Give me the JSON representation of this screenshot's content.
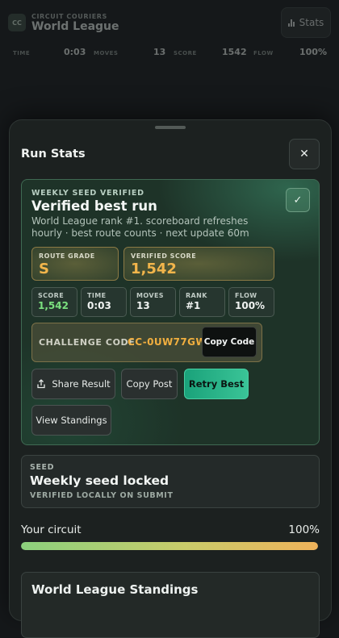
{
  "app": {
    "brand_eyebrow": "CIRCUIT COURIERS",
    "brand_title": "World League",
    "logo_text": "CC",
    "stats_button": "Stats",
    "stats_icon": "bar-chart-icon",
    "metrics": {
      "time_label": "TIME",
      "time_value": "0:03",
      "moves_label": "MOVES",
      "moves_value": "13",
      "score_label": "SCORE",
      "score_value": "1542",
      "flow_label": "FLOW",
      "flow_value": "100%"
    }
  },
  "sheet": {
    "title": "Run Stats",
    "close_icon": "close-icon",
    "verified": {
      "eyebrow": "WEEKLY SEED VERIFIED",
      "title": "Verified best run",
      "description": "World League rank #1. scoreboard refreshes hourly · best route counts · next update 60m",
      "check_icon": "check-icon",
      "route_grade_label": "ROUTE GRADE",
      "route_grade_value": "S",
      "verified_score_label": "VERIFIED SCORE",
      "verified_score_value": "1,542",
      "stats": [
        {
          "label": "SCORE",
          "value": "1,542"
        },
        {
          "label": "TIME",
          "value": "0:03"
        },
        {
          "label": "MOVES",
          "value": "13"
        },
        {
          "label": "RANK",
          "value": "#1"
        },
        {
          "label": "FLOW",
          "value": "100%"
        }
      ],
      "challenge_label": "CHALLENGE CODE",
      "challenge_code": "CC-0UW77GW",
      "copy_code_button": "Copy Code",
      "share_button": "Share Result",
      "share_icon": "share-icon",
      "copy_post_button": "Copy Post",
      "retry_button": "Retry Best",
      "standings_button": "View Standings"
    },
    "seed": {
      "eyebrow": "SEED",
      "title": "Weekly seed locked",
      "subtitle": "VERIFIED LOCALLY ON SUBMIT"
    },
    "circuit": {
      "label": "Your circuit",
      "percent_text": "100%",
      "progress_fraction": 1.0
    },
    "standings_title": "World League Standings"
  },
  "colors": {
    "accent_green": "#3ac497",
    "score_gold": "#f2b54b",
    "code_orange": "#f0ae3f",
    "score_green": "#7be07f"
  }
}
